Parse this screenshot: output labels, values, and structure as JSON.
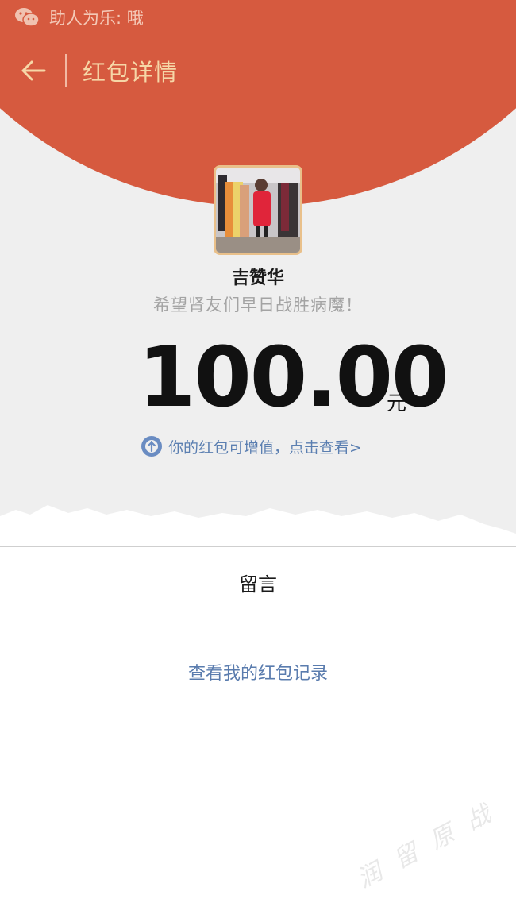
{
  "statusbar": {
    "icon": "wechat-icon",
    "text": "助人为乐: 哦"
  },
  "navbar": {
    "back_icon": "back-arrow-icon",
    "title": "红包详情"
  },
  "envelope": {
    "sender_name": "吉赞华",
    "wish": "希望肾友们早日战胜病魔！",
    "amount": "100.00",
    "unit": "元",
    "upgrade_text": "你的红包可增值，点击查看>"
  },
  "message": {
    "title": "留言"
  },
  "records_link": "查看我的红包记录",
  "watermark": "润 留 原 战",
  "colors": {
    "header_red": "#d65a3f",
    "title_gold": "#f6d7a7",
    "link_blue": "#5a7cae"
  }
}
